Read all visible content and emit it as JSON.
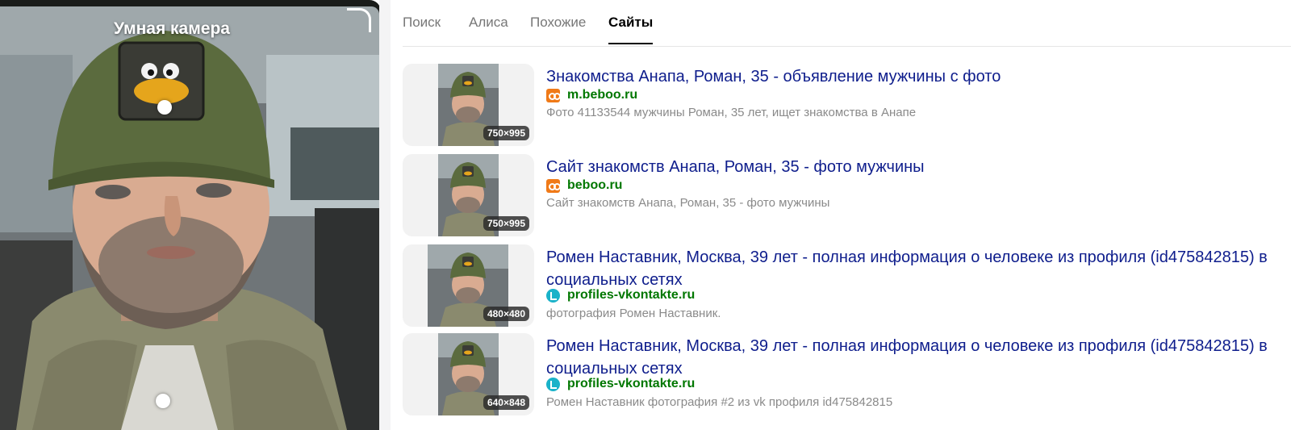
{
  "camera": {
    "title": "Умная камера"
  },
  "tabs": [
    {
      "label": "Поиск",
      "active": false
    },
    {
      "label": "Алиса",
      "active": false
    },
    {
      "label": "Похожие",
      "active": false
    },
    {
      "label": "Сайты",
      "active": true
    }
  ],
  "results": [
    {
      "title": "Знакомства Анапа, Роман, 35 - объявление мужчины с фото",
      "domain": "m.beboo.ru",
      "favicon": "beboo-icon",
      "snippet": "Фото 41133544 мужчины Роман, 35 лет, ищет знакомства в Анапе",
      "size": "750×995"
    },
    {
      "title": "Сайт знакомств Анапа, Роман, 35 - фото мужчины",
      "domain": "beboo.ru",
      "favicon": "beboo-icon",
      "snippet": "Сайт знакомств Анапа, Роман, 35 - фото мужчины",
      "size": "750×995"
    },
    {
      "title": "Ромен Наставник, Москва, 39 лет - полная информация о человеке из профиля (id475842815) в социальных сетях",
      "domain": "profiles-vkontakte.ru",
      "favicon": "vk-profile-icon",
      "snippet": "фотография Ромен Наставник.",
      "size": "480×480"
    },
    {
      "title": "Ромен Наставник, Москва, 39 лет - полная информация о человеке из профиля (id475842815) в социальных сетях",
      "domain": "profiles-vkontakte.ru",
      "favicon": "vk-profile-icon",
      "snippet": "Ромен Наставник фотография #2 из vk профиля id475842815",
      "size": "640×848"
    }
  ],
  "colors": {
    "link": "#0e1d8c",
    "domain": "#007700",
    "snippet": "#8a8a8a",
    "cap": "#5b6b3e"
  }
}
